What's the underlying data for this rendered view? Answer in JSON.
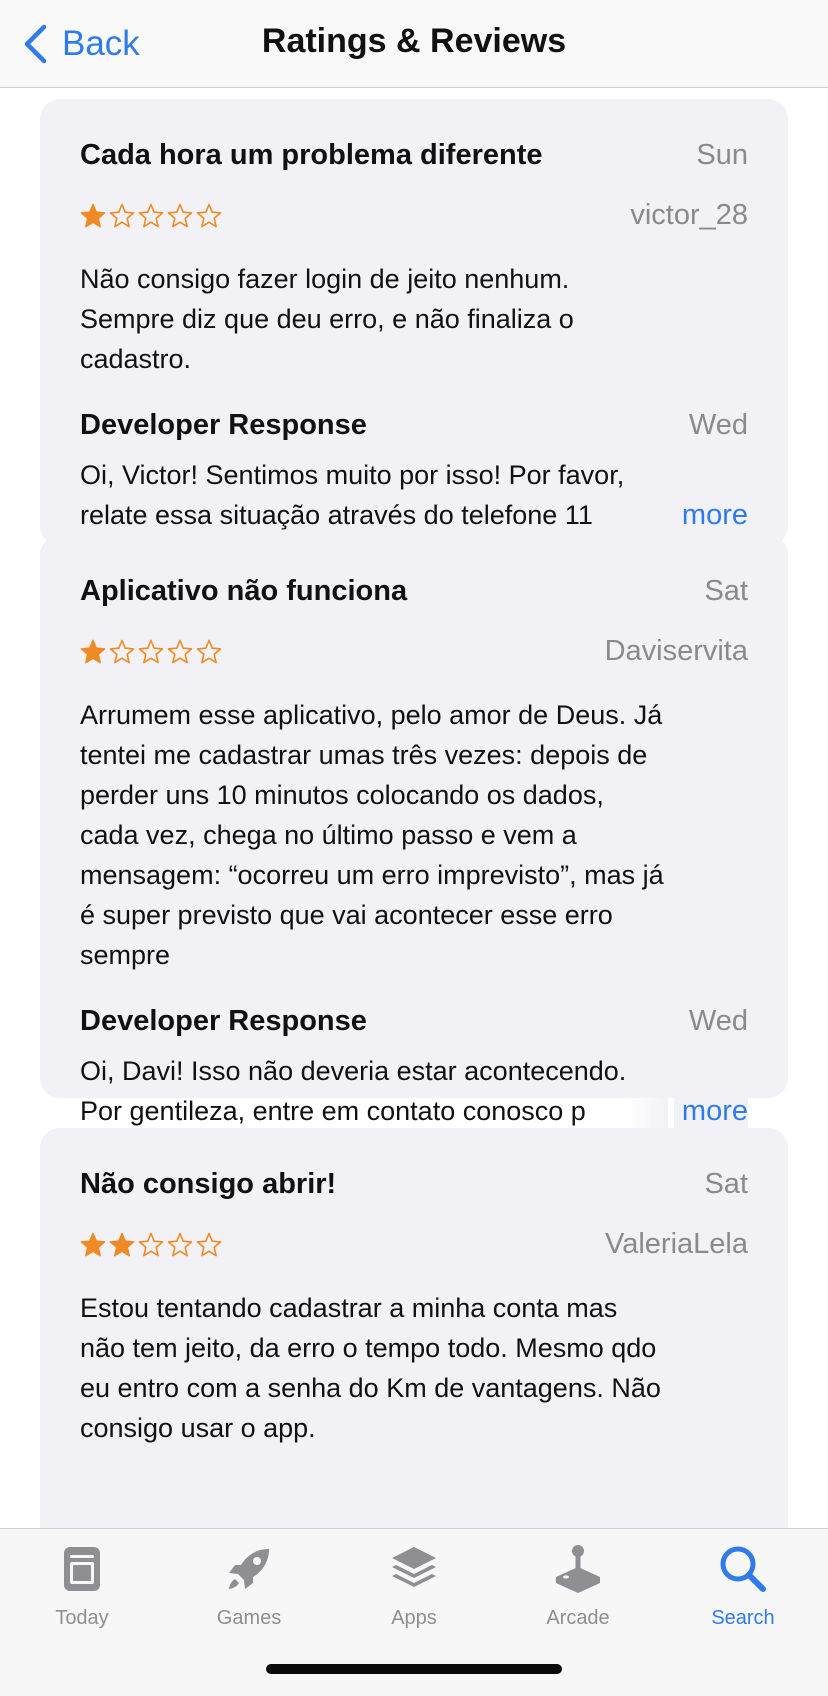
{
  "nav": {
    "back_label": "Back",
    "title": "Ratings & Reviews"
  },
  "colors": {
    "accent": "#2f7bec",
    "star": "#f08a24",
    "card_bg": "#f1f1f6",
    "secondary_text": "#8a8a8e"
  },
  "reviews": [
    {
      "title": "Cada hora um problema diferente",
      "date": "Sun",
      "author": "victor_28",
      "rating": 1,
      "body": [
        "Não consigo fazer login de jeito nenhum.",
        "Sempre diz que deu erro, e não finaliza o",
        "cadastro."
      ],
      "dev_label": "Developer Response",
      "dev_date": "Wed",
      "dev_lines": [
        "Oi, Victor! Sentimos muito por isso! Por favor,",
        "relate essa situação através do telefone 11"
      ],
      "more_label": "more"
    },
    {
      "title": "Aplicativo não funciona",
      "date": "Sat",
      "author": "Daviservita",
      "rating": 1,
      "body": [
        "Arrumem esse aplicativo, pelo amor de Deus. Já",
        "tentei me cadastrar umas três vezes: depois de",
        "perder uns 10 minutos colocando os dados,",
        "cada vez, chega no último passo e vem a",
        "mensagem: “ocorreu um erro imprevisto”, mas já",
        "é super previsto que vai acontecer esse erro",
        "sempre"
      ],
      "dev_label": "Developer Response",
      "dev_date": "Wed",
      "dev_lines": [
        "Oi, Davi! Isso não deveria estar acontecendo.",
        "Por gentileza, entre em contato conosco p"
      ],
      "more_label": "more"
    },
    {
      "title": "Não consigo abrir!",
      "date": "Sat",
      "author": "ValeriaLela",
      "rating": 2,
      "body": [
        "Estou tentando cadastrar a minha conta mas",
        "não tem jeito, da erro o tempo todo. Mesmo qdo",
        "eu entro com a senha do Km de vantagens. Não",
        "consigo usar o app."
      ]
    }
  ],
  "tabs": [
    {
      "label": "Today",
      "icon": "today-icon",
      "active": false
    },
    {
      "label": "Games",
      "icon": "rocket-icon",
      "active": false
    },
    {
      "label": "Apps",
      "icon": "apps-stack-icon",
      "active": false
    },
    {
      "label": "Arcade",
      "icon": "joystick-icon",
      "active": false
    },
    {
      "label": "Search",
      "icon": "search-icon",
      "active": true
    }
  ]
}
